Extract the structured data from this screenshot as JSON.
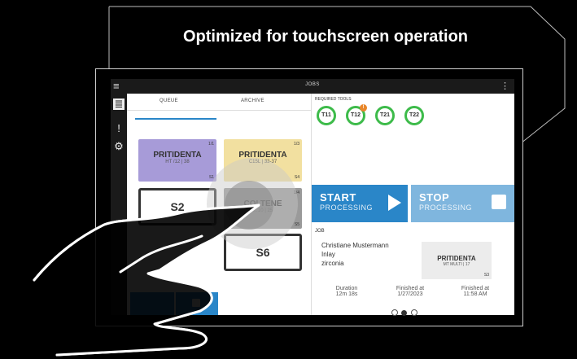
{
  "caption": "Optimized for touchscreen operation",
  "topbar": {
    "title": "JOBS",
    "menu": "⋮"
  },
  "tabs": {
    "queue": "QUEUE",
    "archive": "ARCHIVE"
  },
  "cards": [
    {
      "name": "PRITIDENTA",
      "sub": "HT /12 | 38",
      "idx": "1/1",
      "slot": "S1"
    },
    {
      "name": "PRITIDENTA",
      "sub": "C15L | 33-37",
      "idx": "1/3",
      "slot": "S4"
    },
    {
      "name": "S2"
    },
    {
      "name": "COLTENE",
      "sub": "…10 | 25",
      "idx": "1/4",
      "slot": "S5"
    },
    {
      "name": "S6"
    }
  ],
  "tools": {
    "label": "REQUIRED TOOLS",
    "items": [
      "T11",
      "T12",
      "T21",
      "T22"
    ],
    "badge": "!"
  },
  "start": {
    "big": "START",
    "small": "PROCESSING"
  },
  "stop": {
    "big": "STOP",
    "small": "PROCESSING"
  },
  "job": {
    "label": "JOB",
    "client": "Christiane Mustermann",
    "type": "Inlay",
    "material": "zirconia",
    "mini_name": "PRITIDENTA",
    "mini_sub": "MT MULTI | 17",
    "mini_slot": "S3"
  },
  "stats": [
    {
      "label": "Duration",
      "value": "12m 18s"
    },
    {
      "label": "Finished at",
      "value": "1/27/2023"
    },
    {
      "label": "Finished at",
      "value": "11:58 AM"
    }
  ],
  "colors": {
    "accent": "#2a86c8",
    "tool_ring": "#3dbb4a",
    "purple": "#a79bd8",
    "yellow": "#f2e0a0"
  }
}
